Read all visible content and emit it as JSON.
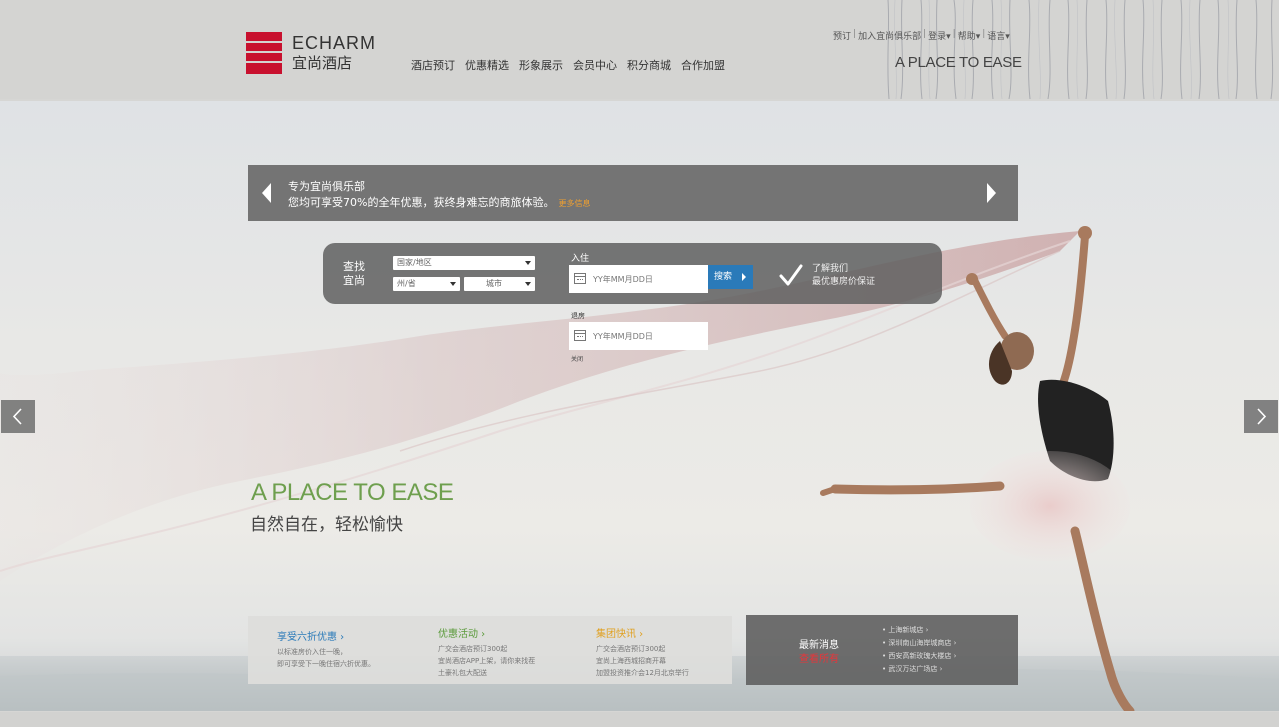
{
  "brand": {
    "name_en": "ECHARM",
    "name_cn": "宜尚酒店",
    "logo_color": "#c8102e"
  },
  "main_nav": [
    "酒店预订",
    "优惠精选",
    "形象展示",
    "会员中心",
    "积分商城",
    "合作加盟"
  ],
  "util_nav": {
    "book": "预订",
    "join": "加入宜尚俱乐部",
    "login": "登录▾",
    "help": "帮助▾",
    "lang": "语言▾"
  },
  "header_tagline": "A PLACE TO EASE",
  "promo": {
    "line1": "专为宜尚俱乐部",
    "line2": "您均可享受70%的全年优惠，获终身难忘的商旅体验。",
    "more": "更多信息"
  },
  "search": {
    "title": "查找宜尚",
    "country_placeholder": "国家/地区",
    "state_placeholder": "州/省",
    "city_placeholder": "城市",
    "checkin_label": "入住",
    "checkin_placeholder": "YY年MM月DD日",
    "checkout_label": "退房",
    "checkout_placeholder": "YY年MM月DD日",
    "button": "搜索",
    "guarantee_line1": "了解我们",
    "guarantee_line2": "最优惠房价保证",
    "close": "关闭"
  },
  "hero": {
    "tagline_en": "A PLACE TO EASE",
    "tagline_cn": "自然自在，轻松愉快",
    "accent_color": "#6e9f4e"
  },
  "panels": {
    "offer": {
      "title": "享受六折优惠",
      "lines": [
        "以标准房价入住一晚，",
        "即可享受下一晚住宿六折优惠。"
      ],
      "color": "#2a7ab9"
    },
    "activities": {
      "title": "优惠活动",
      "lines": [
        "广交会酒店预订300起",
        "宜尚酒店APP上架，请你来找茬",
        "土豪礼包大配送"
      ],
      "color": "#5a9a3a"
    },
    "group_news": {
      "title": "集团快讯",
      "lines": [
        "广交会酒店预订300起",
        "宜尚上海西城招商开幕",
        "加盟投资推介会12月北京举行"
      ],
      "color": "#e0a020"
    }
  },
  "news": {
    "title": "最新消息",
    "view_all": "查看所有",
    "items": [
      "上海新城店",
      "深圳南山海岸城商店",
      "西安高新玫瑰大楼店",
      "武汉万达广场店"
    ]
  }
}
